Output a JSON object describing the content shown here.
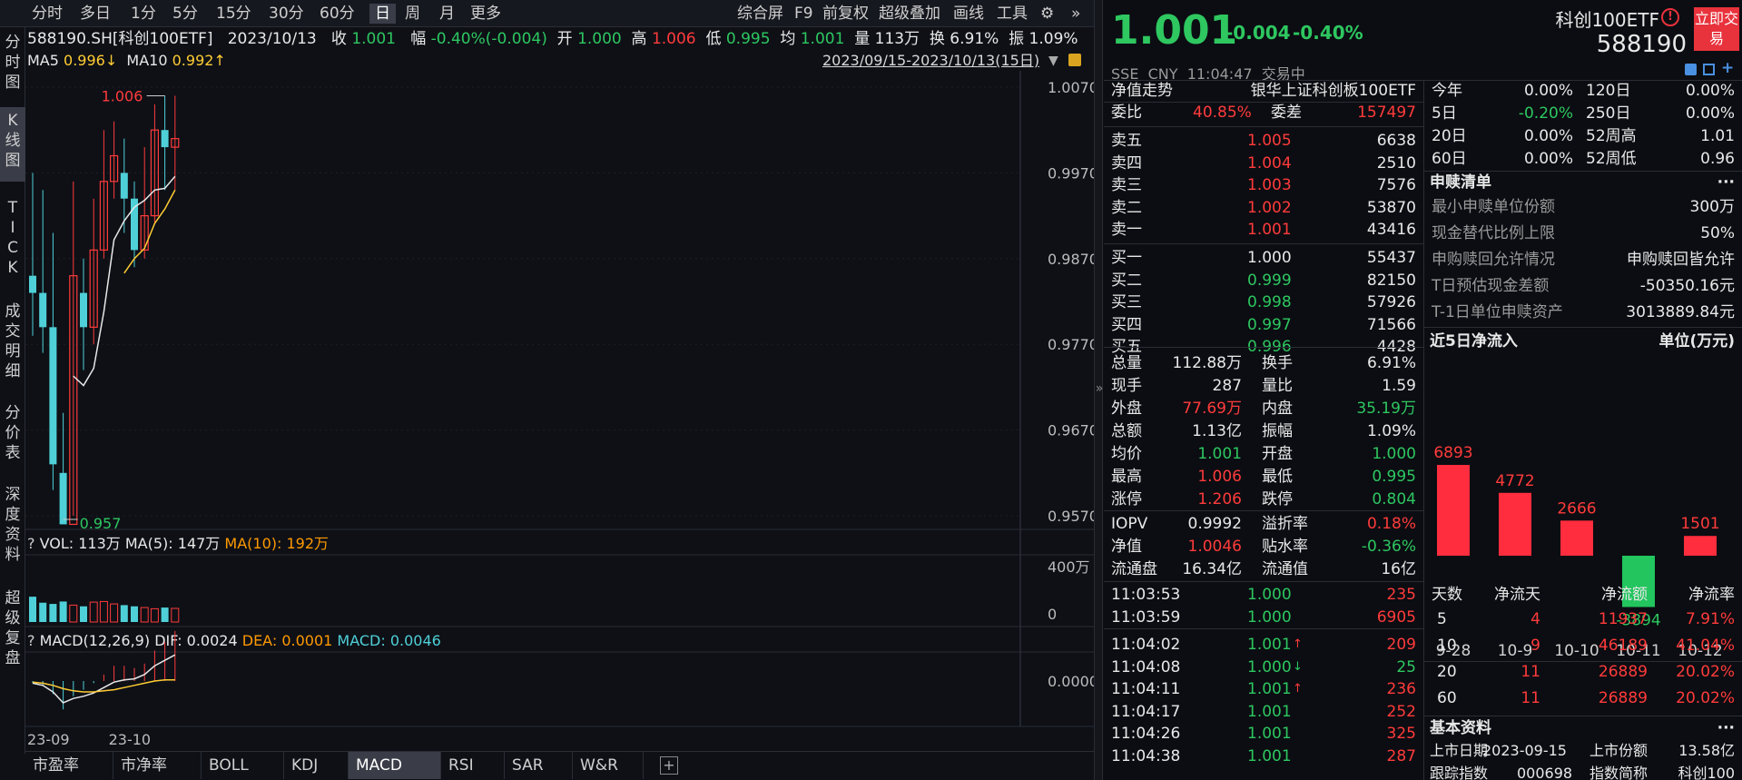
{
  "toolbar": {
    "items": [
      "分时",
      "多日",
      "1分",
      "5分",
      "15分",
      "30分",
      "60分",
      "日",
      "周",
      "月",
      "更多"
    ],
    "selected": "日",
    "right": [
      "综合屏",
      "F9",
      "前复权",
      "超级叠加",
      "画线",
      "工具"
    ]
  },
  "vtabs": [
    "分\n时\n图",
    "K\n线\n图",
    "T\nI\nC\nK",
    "成\n交\n明\n细",
    "分\n价\n表",
    "深\n度\n资\n料",
    "超\n级\n复\n盘"
  ],
  "info": {
    "code": "588190.SH[科创100ETF]",
    "date": "2023/10/13",
    "close_label": "收",
    "close": "1.001",
    "range_label": "幅",
    "range": "-0.40%(-0.004)",
    "open_label": "开",
    "open": "1.000",
    "high_label": "高",
    "high": "1.006",
    "low_label": "低",
    "low": "0.995",
    "avg_label": "均",
    "avg": "1.001",
    "vol_label": "量",
    "vol": "113万",
    "turn_label": "换",
    "turn": "6.91%",
    "amp_label": "振",
    "amp": "1.09%"
  },
  "ma": {
    "ma5_label": "MA5",
    "ma5": "0.996↓",
    "ma10_label": "MA10",
    "ma10": "0.992↑",
    "daterange": "2023/09/15-2023/10/13(15日)"
  },
  "yaxis": [
    "1.0070",
    "0.9970",
    "0.9870",
    "0.9770",
    "0.9670",
    "0.9570"
  ],
  "kline": {
    "open": [
      0.985,
      0.983,
      0.979,
      0.962,
      0.956,
      0.983,
      0.979,
      0.988,
      0.996,
      0.997,
      0.994,
      0.988,
      0.992,
      1.002,
      1.0
    ],
    "close": [
      0.983,
      0.979,
      0.963,
      0.956,
      0.985,
      0.979,
      0.988,
      0.996,
      0.999,
      0.994,
      0.988,
      0.992,
      1.002,
      1.0,
      1.001
    ],
    "high": [
      0.997,
      0.995,
      0.99,
      0.969,
      0.996,
      0.987,
      0.994,
      1.002,
      1.003,
      1.001,
      0.996,
      1.0,
      1.005,
      1.006,
      1.006
    ],
    "low": [
      0.978,
      0.976,
      0.96,
      0.957,
      0.957,
      0.974,
      0.977,
      0.987,
      0.994,
      0.99,
      0.986,
      0.987,
      0.991,
      0.995,
      0.995
    ],
    "ma5": [
      null,
      null,
      null,
      null,
      0.9733,
      0.9722,
      0.9742,
      0.9808,
      0.9892,
      0.9914,
      0.993,
      0.9938,
      0.995,
      0.9952,
      0.9966
    ],
    "ma10": [
      null,
      null,
      null,
      null,
      null,
      null,
      null,
      null,
      null,
      0.9853,
      0.987,
      0.9882,
      0.9911,
      0.9928,
      0.995
    ],
    "max_label": "1.006",
    "min_label": "0.957"
  },
  "volume": {
    "title": "VOL: 113万",
    "ma5": "MA(5): 147万",
    "ma10": "MA(10): 192万",
    "values": [
      210,
      160,
      150,
      170,
      140,
      130,
      165,
      170,
      150,
      140,
      130,
      120,
      110,
      120,
      113
    ],
    "y_top": "400万",
    "y_bottom": "0"
  },
  "macd": {
    "title": "MACD(12,26,9)",
    "dif": "DIF: 0.0024",
    "dea": "DEA: 0.0001",
    "macd": "MACD: 0.0046",
    "zero": "0.0000",
    "dif_vals": [
      -0.0002,
      -0.0004,
      -0.001,
      -0.002,
      -0.0016,
      -0.0014,
      -0.0011,
      -0.0006,
      -0.0001,
      0.0001,
      0.0002,
      0.0006,
      0.0014,
      0.0019,
      0.0024
    ],
    "dea_vals": [
      -0.0001,
      -0.0002,
      -0.0004,
      -0.0007,
      -0.0009,
      -0.001,
      -0.001,
      -0.0009,
      -0.0008,
      -0.0006,
      -0.0004,
      -0.0002,
      0.0,
      0.0001,
      0.0001
    ]
  },
  "xaxis": [
    "23-09",
    "23-10"
  ],
  "bottomtabs": [
    "市盈率",
    "市净率",
    "BOLL",
    "KDJ",
    "MACD",
    "RSI",
    "SAR",
    "W&R"
  ],
  "bottom_selected": "MACD",
  "quote": {
    "price": "1.001",
    "change": "-0.004",
    "pct": "-0.40%",
    "name": "科创100ETF",
    "code": "588190",
    "market": "SSE",
    "currency": "CNY",
    "time": "11:04:47",
    "status": "交易中",
    "trade_btn": "立即交易"
  },
  "nav": {
    "label": "净值走势",
    "fund": "银华上证科创板100ETF"
  },
  "weibi": {
    "label": "委比",
    "value": "40.85%",
    "cha_label": "委差",
    "cha": "157497"
  },
  "asks": [
    {
      "l": "卖五",
      "p": "1.005",
      "v": "6638"
    },
    {
      "l": "卖四",
      "p": "1.004",
      "v": "2510"
    },
    {
      "l": "卖三",
      "p": "1.003",
      "v": "7576"
    },
    {
      "l": "卖二",
      "p": "1.002",
      "v": "53870"
    },
    {
      "l": "卖一",
      "p": "1.001",
      "v": "43416"
    }
  ],
  "bids": [
    {
      "l": "买一",
      "p": "1.000",
      "v": "55437"
    },
    {
      "l": "买二",
      "p": "0.999",
      "v": "82150"
    },
    {
      "l": "买三",
      "p": "0.998",
      "v": "57926"
    },
    {
      "l": "买四",
      "p": "0.997",
      "v": "71566"
    },
    {
      "l": "买五",
      "p": "0.996",
      "v": "4428"
    }
  ],
  "stats": [
    {
      "l1": "总量",
      "v1": "112.88万",
      "c1": "w",
      "l2": "换手",
      "v2": "6.91%",
      "c2": "w"
    },
    {
      "l1": "现手",
      "v1": "287",
      "c1": "w",
      "l2": "量比",
      "v2": "1.59",
      "c2": "w"
    },
    {
      "l1": "外盘",
      "v1": "77.69万",
      "c1": "r",
      "l2": "内盘",
      "v2": "35.19万",
      "c2": "g"
    },
    {
      "l1": "总额",
      "v1": "1.13亿",
      "c1": "w",
      "l2": "振幅",
      "v2": "1.09%",
      "c2": "w"
    },
    {
      "l1": "均价",
      "v1": "1.001",
      "c1": "g",
      "l2": "开盘",
      "v2": "1.000",
      "c2": "g"
    },
    {
      "l1": "最高",
      "v1": "1.006",
      "c1": "r",
      "l2": "最低",
      "v2": "0.995",
      "c2": "g"
    },
    {
      "l1": "涨停",
      "v1": "1.206",
      "c1": "r",
      "l2": "跌停",
      "v2": "0.804",
      "c2": "g"
    }
  ],
  "iopv": [
    {
      "l1": "IOPV",
      "v1": "0.9992",
      "c1": "w",
      "l2": "溢折率",
      "v2": "0.18%",
      "c2": "r"
    },
    {
      "l1": "净值",
      "v1": "1.0046",
      "c1": "r",
      "l2": "贴水率",
      "v2": "-0.36%",
      "c2": "g"
    },
    {
      "l1": "流通盘",
      "v1": "16.34亿",
      "c1": "w",
      "l2": "流通值",
      "v2": "16亿",
      "c2": "w"
    }
  ],
  "ticks": [
    {
      "t": "11:03:53",
      "p": "1.000",
      "a": "",
      "v": "235",
      "vc": "r"
    },
    {
      "t": "11:03:59",
      "p": "1.000",
      "a": "",
      "v": "6905",
      "vc": "r"
    },
    {
      "t": "11:04:02",
      "p": "1.001",
      "a": "↑",
      "v": "209",
      "vc": "r"
    },
    {
      "t": "11:04:08",
      "p": "1.000",
      "a": "↓",
      "v": "25",
      "vc": "g"
    },
    {
      "t": "11:04:11",
      "p": "1.001",
      "a": "↑",
      "v": "236",
      "vc": "r"
    },
    {
      "t": "11:04:17",
      "p": "1.001",
      "a": "",
      "v": "252",
      "vc": "r"
    },
    {
      "t": "11:04:26",
      "p": "1.001",
      "a": "",
      "v": "325",
      "vc": "r"
    },
    {
      "t": "11:04:38",
      "p": "1.001",
      "a": "",
      "v": "287",
      "vc": "r"
    }
  ],
  "perf": [
    {
      "l1": "今年",
      "v1": "0.00%",
      "c1": "w",
      "l2": "120日",
      "v2": "0.00%"
    },
    {
      "l1": "5日",
      "v1": "-0.20%",
      "c1": "g",
      "l2": "250日",
      "v2": "0.00%"
    },
    {
      "l1": "20日",
      "v1": "0.00%",
      "c1": "w",
      "l2": "52周高",
      "v2": "1.01"
    },
    {
      "l1": "60日",
      "v1": "0.00%",
      "c1": "w",
      "l2": "52周低",
      "v2": "0.96"
    }
  ],
  "shenshu": {
    "title": "申赎清单",
    "more": "···",
    "rows": [
      {
        "l": "最小申赎单位份额",
        "v": "300万"
      },
      {
        "l": "现金替代比例上限",
        "v": "50%"
      },
      {
        "l": "申购赎回允许情况",
        "v": "申购赎回皆允许"
      },
      {
        "l": "T日预估现金差额",
        "v": "-50350.16元"
      },
      {
        "l": "T-1日单位申赎资产",
        "v": "3013889.84元"
      }
    ]
  },
  "flow": {
    "title": "近5日净流入",
    "unit": "单位(万元)",
    "dates": [
      "9-28",
      "10-9",
      "10-10",
      "10-11",
      "10-12"
    ],
    "values": [
      6893,
      4772,
      2666,
      -3894,
      1501
    ]
  },
  "flowtable": {
    "headers": [
      "天数",
      "净流天",
      "净流额",
      "净流率"
    ],
    "rows": [
      [
        "5",
        "4",
        "11937",
        "7.91%"
      ],
      [
        "10",
        "9",
        "46189",
        "41.04%"
      ],
      [
        "20",
        "11",
        "26889",
        "20.02%"
      ],
      [
        "60",
        "11",
        "26889",
        "20.02%"
      ]
    ]
  },
  "basic": {
    "title": "基本资料",
    "more": "···",
    "l1": "上市日期",
    "v1": "2023-09-15",
    "l2": "上市份额",
    "v2": "13.58亿",
    "l3": "跟踪指数",
    "v3": "000698",
    "l4": "指数简称",
    "v4": "科创100"
  }
}
